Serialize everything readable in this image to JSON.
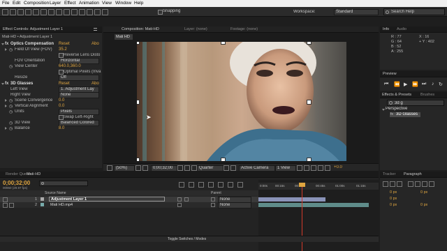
{
  "menubar": {
    "items": [
      "File",
      "Edit",
      "Composition",
      "Layer",
      "Effect",
      "Animation",
      "View",
      "Window",
      "Help"
    ]
  },
  "toolbar": {
    "snapping_label": "Snapping",
    "workspace_label": "Workspace:",
    "workspace_value": "Standard",
    "search_placeholder": "Search Help"
  },
  "effect_controls": {
    "tab_label": "Effect Controls: Adjustment Layer 1",
    "subtitle": "Mati-HD • Adjustment Layer 1",
    "optics": {
      "name": "Optics Compensation",
      "reset": "Reset",
      "about": "Abo",
      "fov_label": "Field Of View (FOV)",
      "fov_value": "35.2",
      "reverse_label": "Reverse Lens Disto",
      "fov_orientation_label": "FOV Orientation",
      "fov_orientation_value": "Horizontal",
      "view_center_label": "View Center",
      "view_center_value": "640.0,360.0",
      "optimal_label": "Optimal Pixels (Inva",
      "resize_label": "Resize",
      "resize_value": "Off"
    },
    "glasses": {
      "name": "3D Glasses",
      "reset": "Reset",
      "about": "Abo",
      "left_view_label": "Left View",
      "left_view_value": "1. Adjustment Lay",
      "right_view_label": "Right View",
      "right_view_value": "None",
      "scene_convergence_label": "Scene Convergence",
      "scene_convergence_value": "0.0",
      "vertical_alignment_label": "Vertical Alignment",
      "vertical_alignment_value": "0.0",
      "units_label": "Units",
      "units_value": "Pixels",
      "swap_label": "Swap Left-Right",
      "view_label": "3D View",
      "view_value": "Balanced Colored",
      "balance_label": "Balance",
      "balance_value": "8.0"
    }
  },
  "composition": {
    "tab_label": "Composition: Mati-HD",
    "layer_tab": "Layer: (none)",
    "footage_tab": "Footage: (none)",
    "sub_tab": "Mati HD",
    "zoom": "(50%)",
    "timecode": "0;00;32;00",
    "resolution": "Quarter",
    "camera": "Active Camera",
    "views": "1 View",
    "exposure": "+0.0"
  },
  "info": {
    "tab_label": "Info",
    "audio_tab": "Audio",
    "r": "R : 77",
    "g": "G : 64",
    "b": "B : 52",
    "a": "A : 255",
    "x": "X : 16",
    "y": "+ Y : 402"
  },
  "preview": {
    "tab_label": "Preview"
  },
  "effects_presets": {
    "tab_label": "Effects & Presets",
    "brushes_tab": "Brushes",
    "search_value": "3d g",
    "category": "Perspective",
    "item": "3D Glasses"
  },
  "timeline": {
    "tab_render": "Render Queue",
    "tab_comp": "Mati-HD",
    "timecode": "0;00;32;00",
    "fps_info": "00960 (29.97 fps)",
    "source_header": "Source Name",
    "parent_header": "Parent",
    "ruler": [
      "0:00s",
      "00:15s",
      "00:30s",
      "00:45s",
      "01:00s",
      "01:15s"
    ],
    "layers": [
      {
        "num": "1",
        "name": "Adjustment Layer 1",
        "parent": "None"
      },
      {
        "num": "2",
        "name": "Mati HD.mp4",
        "parent": "None"
      }
    ],
    "toggle_label": "Toggle Switches / Modes"
  },
  "tracker": {
    "tab_label": "Tracker",
    "paragraph_tab": "Paragraph",
    "px_values": [
      "0 px",
      "0 px",
      "0 px",
      "0 px",
      "0 px"
    ]
  },
  "colors": {
    "accent_orange": "#e0a640",
    "layer1_bar": "#8a93b8",
    "layer2_bar": "#5f8c8a",
    "playhead": "#d23b2a"
  }
}
